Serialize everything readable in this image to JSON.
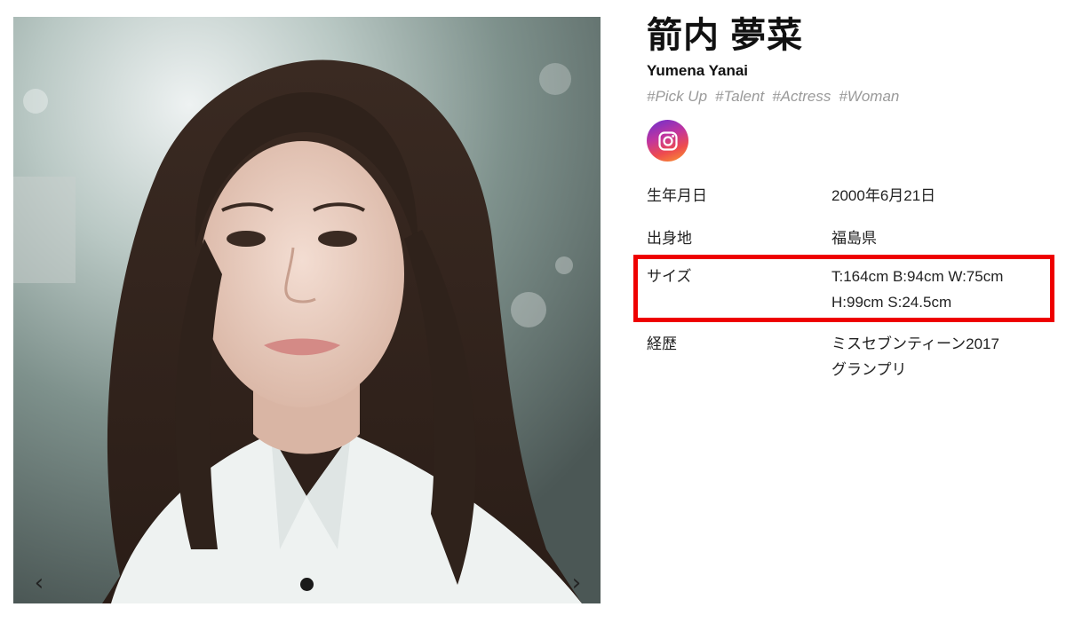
{
  "carousel": {
    "photo_alt": "portrait photo",
    "prev_icon": "chevron-left-icon",
    "next_icon": "chevron-right-icon",
    "prev_glyph": "‹",
    "next_glyph": "›",
    "slide_count": 1,
    "active_slide": 1
  },
  "profile": {
    "name_jp": "箭内 夢菜",
    "name_en": "Yumena Yanai",
    "tags": [
      "#Pick Up",
      "#Talent",
      "#Actress",
      "#Woman"
    ],
    "social_icon": "instagram-icon"
  },
  "info": {
    "birth": {
      "label": "生年月日",
      "value": "2000年6月21日"
    },
    "hometown": {
      "label": "出身地",
      "value": "福島県"
    },
    "size": {
      "label": "サイズ",
      "line1": "T:164cm B:94cm W:75cm",
      "line2": "H:99cm S:24.5cm"
    },
    "career": {
      "label": "経歴",
      "line1": "ミスセブンティーン2017",
      "line2": "グランプリ"
    }
  },
  "colors": {
    "highlight": "#ee0000",
    "tag": "#9a9a9a",
    "text": "#222222"
  }
}
